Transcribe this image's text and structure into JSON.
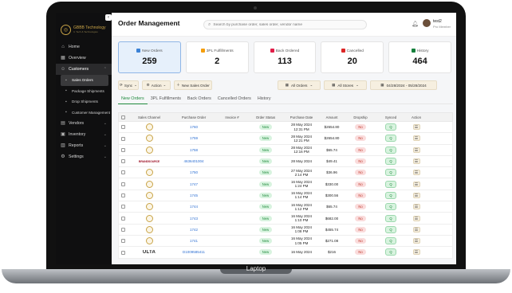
{
  "device_label": "Laptop",
  "sidebar": {
    "brand": "GBBB Technology",
    "brand_sub": "It. Tech & Technologies",
    "items": [
      {
        "label": "Home",
        "icon": "home-icon"
      },
      {
        "label": "Overview",
        "icon": "grid-icon"
      },
      {
        "label": "Customers",
        "icon": "users-icon",
        "expanded": true
      },
      {
        "label": "Vendors",
        "icon": "store-icon"
      },
      {
        "label": "Inventory",
        "icon": "box-icon"
      },
      {
        "label": "Reports",
        "icon": "chart-icon"
      },
      {
        "label": "Settings",
        "icon": "gear-icon"
      }
    ],
    "sub_items": [
      {
        "label": "Sales Orders",
        "active": true
      },
      {
        "label": "Package Shipments"
      },
      {
        "label": "Drop Shipments"
      },
      {
        "label": "Customer Management"
      }
    ]
  },
  "header": {
    "title": "Order Management",
    "search_placeholder": "Search by purchase order, sales order, vendor name",
    "user_name": "test2",
    "user_role": "Pro Member"
  },
  "cards": [
    {
      "label": "New Orders",
      "value": "259",
      "color": "#3b82d6",
      "active": true
    },
    {
      "label": "3PL Fulfillments",
      "value": "2",
      "color": "#f59e0b"
    },
    {
      "label": "Back Ordered",
      "value": "113",
      "color": "#e11d48"
    },
    {
      "label": "Cancelled",
      "value": "20",
      "color": "#dc2626"
    },
    {
      "label": "History",
      "value": "464",
      "color": "#16803c"
    }
  ],
  "toolbar": {
    "sync": "Sync",
    "action": "Action",
    "new_sales_order": "New Sales Order",
    "orders_filter": "All Orders",
    "stores_filter": "All Stores",
    "date_range": "04/28/2024 - 05/28/2024"
  },
  "tabs": [
    "New Orders",
    "3PL Fulfillments",
    "Back Orders",
    "Cancelled Orders",
    "History"
  ],
  "table": {
    "columns": [
      "",
      "Sales Channel",
      "Purchase Order",
      "Invoice #",
      "Order Status",
      "Purchase Date",
      "Amount",
      "Dropship",
      "Synced",
      "Action"
    ],
    "rows": [
      {
        "channel": "round",
        "po": "1760",
        "status": "New",
        "date": "28 May 2024",
        "time": "12:31 PM",
        "amount": "$2654.80",
        "dropship": "No",
        "synced": "Q"
      },
      {
        "channel": "round",
        "po": "1759",
        "status": "New",
        "date": "28 May 2024",
        "time": "12:21 PM",
        "amount": "$2654.80",
        "dropship": "No",
        "synced": "Q"
      },
      {
        "channel": "round",
        "po": "1758",
        "status": "New",
        "date": "28 May 2024",
        "time": "12:16 PM",
        "amount": "$65.74",
        "dropship": "No",
        "synced": "Q"
      },
      {
        "channel": "wide",
        "channel_text": "BRANDSOURCE",
        "po": "4636401004",
        "status": "New",
        "date": "28 May 2024",
        "time": "",
        "amount": "$49.41",
        "dropship": "No",
        "synced": "Q"
      },
      {
        "channel": "round",
        "po": "1750",
        "status": "New",
        "date": "27 May 2024",
        "time": "2:14 PM",
        "amount": "$36.96",
        "dropship": "No",
        "synced": "Q"
      },
      {
        "channel": "round",
        "po": "1747",
        "status": "New",
        "date": "16 May 2024",
        "time": "1:24 PM",
        "amount": "$330.00",
        "dropship": "No",
        "synced": "Q"
      },
      {
        "channel": "round",
        "po": "1745",
        "status": "New",
        "date": "16 May 2024",
        "time": "1:14 PM",
        "amount": "$300.56",
        "dropship": "No",
        "synced": "Q"
      },
      {
        "channel": "round",
        "po": "1744",
        "status": "New",
        "date": "16 May 2024",
        "time": "1:12 PM",
        "amount": "$65.74",
        "dropship": "No",
        "synced": "Q"
      },
      {
        "channel": "round",
        "po": "1743",
        "status": "New",
        "date": "16 May 2024",
        "time": "1:10 PM",
        "amount": "$682.00",
        "dropship": "No",
        "synced": "Q"
      },
      {
        "channel": "round",
        "po": "1742",
        "status": "New",
        "date": "16 May 2024",
        "time": "1:08 PM",
        "amount": "$455.74",
        "dropship": "No",
        "synced": "Q"
      },
      {
        "channel": "round",
        "po": "1741",
        "status": "New",
        "date": "16 May 2024",
        "time": "1:05 PM",
        "amount": "$271.08",
        "dropship": "No",
        "synced": "Q"
      },
      {
        "channel": "ulta",
        "channel_text": "ULTA",
        "po": "D1009585411",
        "status": "New",
        "date": "16 May 2024",
        "time": "",
        "amount": "$216",
        "dropship": "No",
        "synced": "Q"
      }
    ]
  }
}
